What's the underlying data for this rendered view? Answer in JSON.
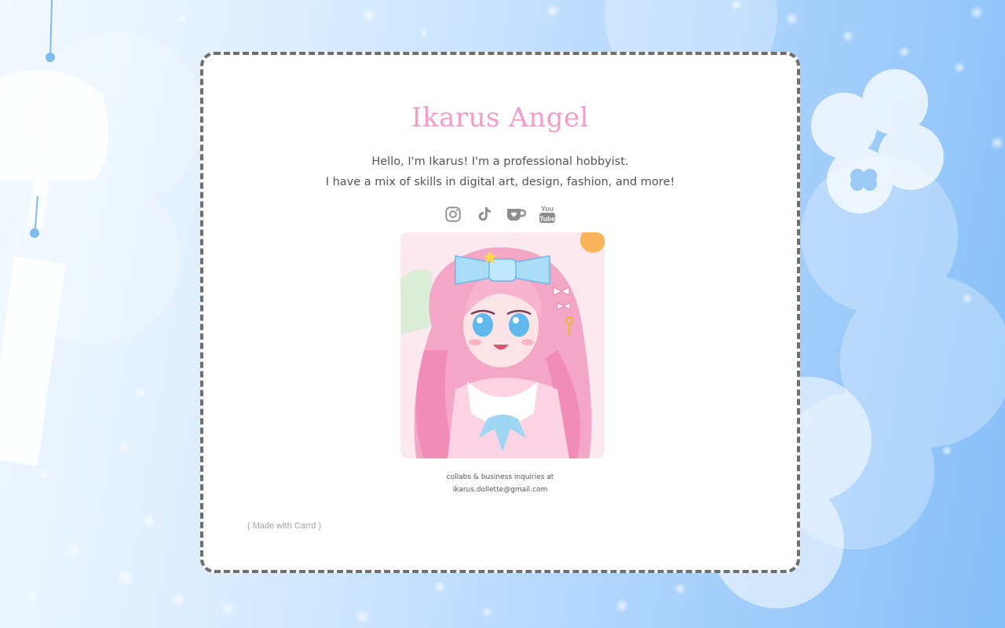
{
  "profile": {
    "name": "Ikarus Angel",
    "bio_line_1": "Hello, I'm Ikarus! I'm a professional hobbyist.",
    "bio_line_2": "I have a mix of skills in digital art, design, fashion, and more!",
    "contact_line_1": "collabs & business inquiries at",
    "contact_line_2": "ikarus.dollette@gmail.com"
  },
  "socials": [
    {
      "icon": "instagram-icon"
    },
    {
      "icon": "tiktok-icon"
    },
    {
      "icon": "kofi-icon"
    },
    {
      "icon": "youtube-icon",
      "label_top": "You",
      "label_bottom": "Tube"
    }
  ],
  "footer": {
    "made_with": "( Made with Carrd )"
  },
  "colors": {
    "title": "#f39bc9",
    "text": "#555555",
    "icon": "#8e8e8e",
    "card_border": "#6f6f6f",
    "background_light": "#f4f9ff",
    "background_dark": "#86bff8"
  }
}
